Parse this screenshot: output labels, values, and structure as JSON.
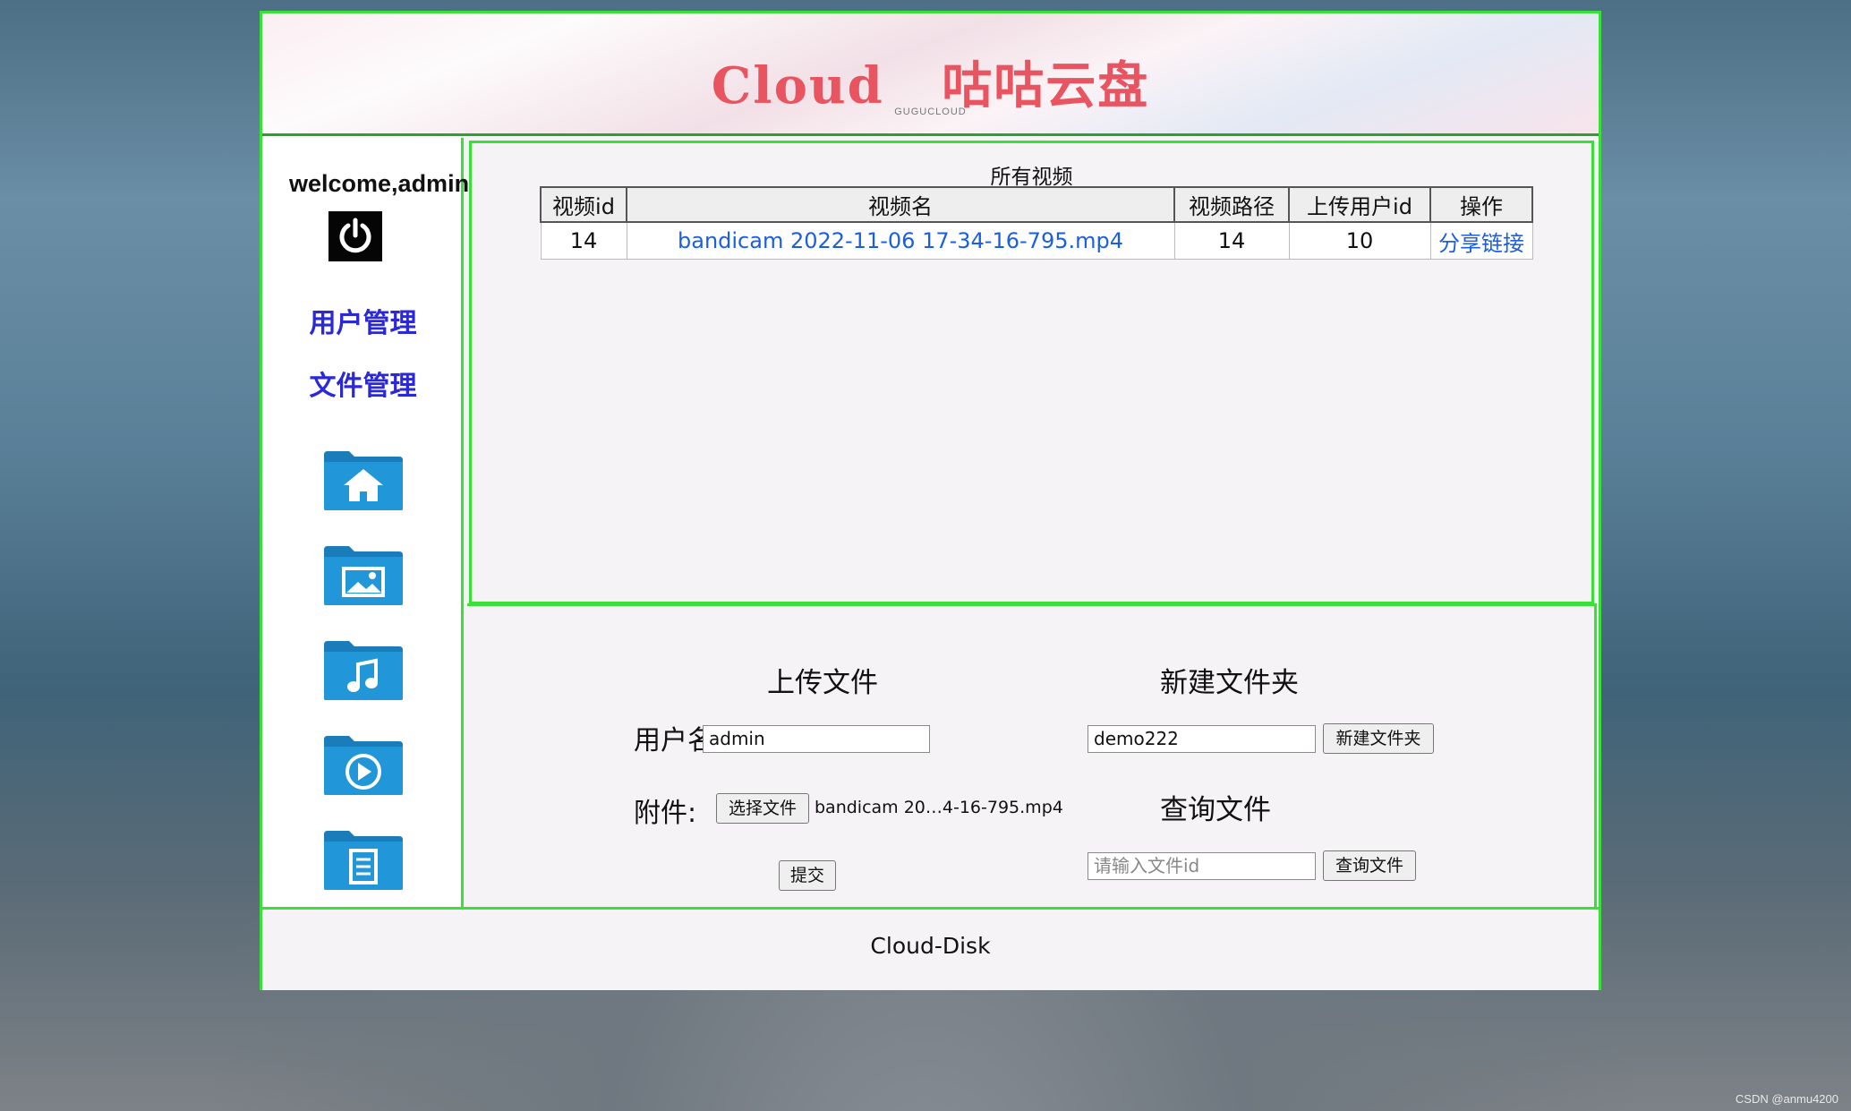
{
  "banner": {
    "title": "Cloud   咕咕云盘",
    "subtitle": "GUGUCLOUD"
  },
  "sidebar": {
    "welcome": "welcome,admin!",
    "logout_icon": "power-icon",
    "links": [
      "用户管理",
      "文件管理"
    ],
    "folders": [
      {
        "icon": "folder-home-icon"
      },
      {
        "icon": "folder-image-icon"
      },
      {
        "icon": "folder-music-icon"
      },
      {
        "icon": "folder-video-icon"
      },
      {
        "icon": "folder-document-icon"
      }
    ]
  },
  "videos": {
    "title": "所有视频",
    "columns": [
      "视频id",
      "视频名",
      "视频路径",
      "上传用户id",
      "操作"
    ],
    "rows": [
      {
        "id": "14",
        "name": "bandicam 2022-11-06 17-34-16-795.mp4",
        "path": "14",
        "user_id": "10",
        "action": "分享链接"
      }
    ]
  },
  "upload": {
    "heading": "上传文件",
    "username_label": "用户名:",
    "username_value": "admin",
    "attachment_label": "附件:",
    "choose_file_button": "选择文件",
    "chosen_file": "bandicam 20…4-16-795.mp4",
    "submit_button": "提交"
  },
  "new_folder": {
    "heading": "新建文件夹",
    "value": "demo222",
    "button": "新建文件夹"
  },
  "query_file": {
    "heading": "查询文件",
    "placeholder": "请输入文件id",
    "button": "查询文件"
  },
  "footer": {
    "text": "Cloud-Disk"
  },
  "watermark": "CSDN @anmu4200",
  "colors": {
    "border": "#38e038",
    "nav_link": "#2b28d8",
    "link": "#1a5fe0",
    "folder": "#1e8fd0",
    "title": "#e8545f"
  }
}
